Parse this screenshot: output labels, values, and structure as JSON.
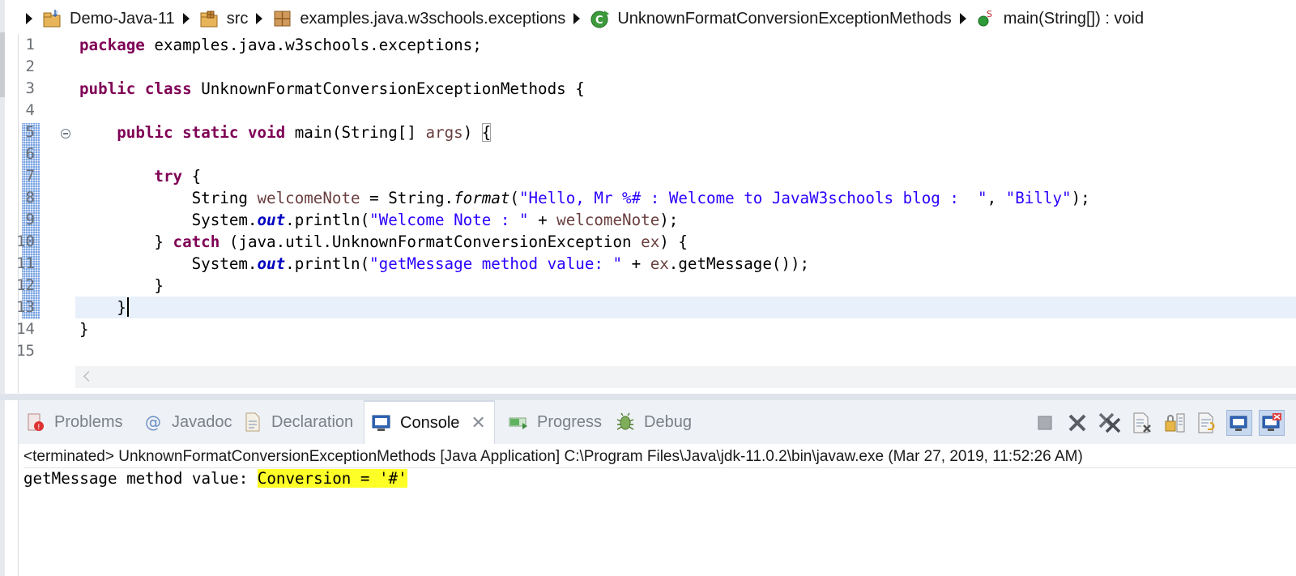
{
  "breadcrumb": {
    "items": [
      {
        "label": "Demo-Java-11",
        "icon": "project-icon"
      },
      {
        "label": "src",
        "icon": "source-folder-icon"
      },
      {
        "label": "examples.java.w3schools.exceptions",
        "icon": "package-icon"
      },
      {
        "label": "UnknownFormatConversionExceptionMethods",
        "icon": "class-icon"
      },
      {
        "label": "main(String[]) : void",
        "icon": "static-method-icon"
      }
    ]
  },
  "editor": {
    "line_numbers": [
      "1",
      "2",
      "3",
      "4",
      "5",
      "6",
      "7",
      "8",
      "9",
      "10",
      "11",
      "12",
      "13",
      "14",
      "15"
    ],
    "current_line": 13
  },
  "panel": {
    "tabs": [
      {
        "label": "Problems",
        "icon": "problems-icon"
      },
      {
        "label": "Javadoc",
        "icon": "javadoc-icon"
      },
      {
        "label": "Declaration",
        "icon": "declaration-icon"
      },
      {
        "label": "Console",
        "icon": "console-icon",
        "active": true
      },
      {
        "label": "Progress",
        "icon": "progress-icon"
      },
      {
        "label": "Debug",
        "icon": "debug-icon"
      }
    ],
    "close_glyph": "✕",
    "console_status": "<terminated> UnknownFormatConversionExceptionMethods [Java Application] C:\\Program Files\\Java\\jdk-11.0.2\\bin\\javaw.exe (Mar 27, 2019, 11:52:26 AM)",
    "output_prefix": "getMessage method value: ",
    "output_highlight": "Conversion = '#'",
    "highlight_color": "#ffff28"
  },
  "colors": {
    "keyword": "#7f0055",
    "string": "#2a00ff",
    "local_variable": "#6a3e3e",
    "static_field": "#0000c0",
    "current_line_bg": "#e8f0fb"
  }
}
